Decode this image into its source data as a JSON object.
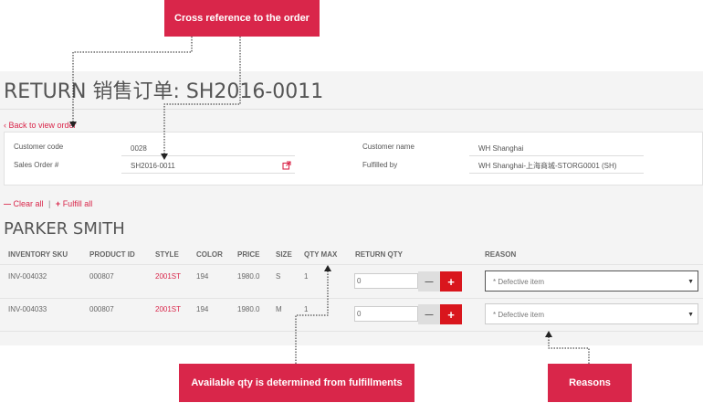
{
  "callouts": {
    "cross_reference": "Cross reference to the order",
    "available_qty": "Available qty is determined from fulfillments",
    "reasons": "Reasons"
  },
  "page": {
    "title": "RETURN 销售订单: SH2016-0011",
    "back_link": "Back to view order"
  },
  "order_info": {
    "customer_code_label": "Customer code",
    "customer_code": "0028",
    "sales_order_label": "Sales Order #",
    "sales_order": "SH2016-0011",
    "customer_name_label": "Customer name",
    "customer_name": "WH Shanghai",
    "fulfilled_by_label": "Fulfilled by",
    "fulfilled_by": "WH Shanghai-上海商城-STORG0001 (SH)"
  },
  "actions": {
    "clear_all": "Clear all",
    "separator": "|",
    "fulfill_all": "Fulfill all"
  },
  "customer": {
    "name": "PARKER SMITH"
  },
  "table": {
    "headers": {
      "sku": "INVENTORY SKU",
      "product_id": "PRODUCT ID",
      "style": "STYLE",
      "color": "COLOR",
      "price": "PRICE",
      "size": "SIZE",
      "qty_max": "QTY MAX",
      "return_qty": "RETURN QTY",
      "reason": "REASON"
    },
    "rows": [
      {
        "sku": "INV-004032",
        "product_id": "000807",
        "style": "2001ST",
        "color": "194",
        "price": "1980.0",
        "size": "S",
        "qty_max": "1",
        "return_qty": "0",
        "reason": "* Defective item"
      },
      {
        "sku": "INV-004033",
        "product_id": "000807",
        "style": "2001ST",
        "color": "194",
        "price": "1980.0",
        "size": "M",
        "qty_max": "1",
        "return_qty": "0",
        "reason": "* Defective item"
      }
    ]
  },
  "icons": {
    "back": "chevron-left-icon",
    "external_link": "external-link-icon",
    "minus": "minus-icon",
    "plus": "plus-icon",
    "dropdown": "caret-down-icon"
  },
  "colors": {
    "accent": "#d9264a",
    "plus_button": "#d9161d",
    "minus_button": "#dedede",
    "callout_text": "#ffffff"
  },
  "glyphs": {
    "chevron_left": "‹",
    "minus": "—",
    "plus": "+",
    "caret_down": "▼"
  }
}
